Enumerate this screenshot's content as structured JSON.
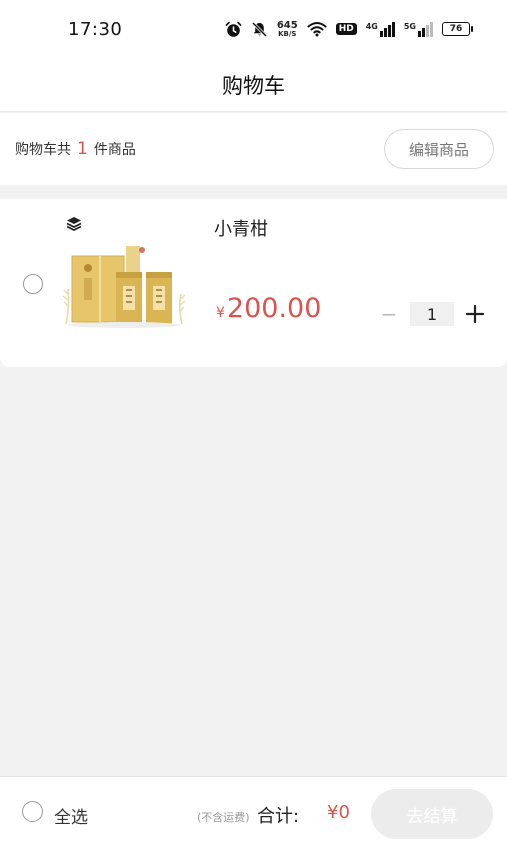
{
  "status_bar": {
    "time": "17:30",
    "speed_value": "645",
    "speed_unit": "KB/S",
    "hd_label": "HD",
    "net1_label": "4G",
    "net2_label": "5G",
    "battery": "76"
  },
  "nav": {
    "title": "购物车"
  },
  "summary": {
    "prefix": "购物车共",
    "count": "1",
    "suffix": "件商品",
    "edit_label": "编辑商品"
  },
  "cart_items": [
    {
      "name": "小青柑",
      "currency": "¥",
      "price": "200.00",
      "quantity": "1",
      "minus_label": "−",
      "selected": false
    }
  ],
  "bottom_bar": {
    "select_all_label": "全选",
    "shipping_note": "(不含运费)",
    "total_label": "合计:",
    "total_value": "¥0",
    "checkout_label": "去结算"
  },
  "colors": {
    "accent": "#d9534f",
    "background": "#f2f2f2",
    "checkout_disabled": "#ececec"
  },
  "icons": {
    "status": [
      "alarm-icon",
      "mute-icon",
      "wifi-icon",
      "signal-icon",
      "battery-icon"
    ],
    "store": "store-icon",
    "plus": "plus-icon"
  }
}
